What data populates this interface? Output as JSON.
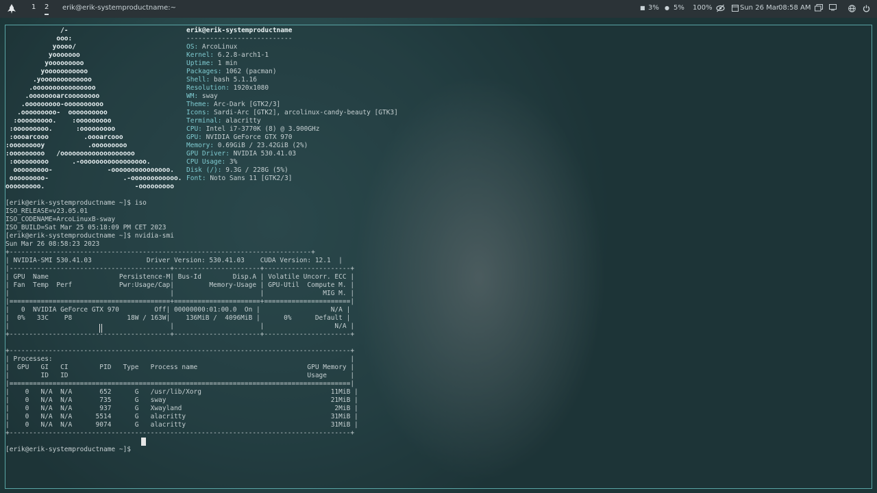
{
  "topbar": {
    "workspaces": [
      "1",
      "2"
    ],
    "window_title": "erik@erik-systemproductname:~",
    "cpu": "3%",
    "mem": "5%",
    "brightness": "100%",
    "date": "Sun 26 Mar",
    "time": "08:58 AM"
  },
  "terminal": {
    "logo_lines": [
      "              /-",
      "             ooo:",
      "            yoooo/",
      "           yooooooo",
      "          yooooooooo",
      "         yooooooooooo",
      "       .yooooooooooooo",
      "      .oooooooooooooooo",
      "     .oooooooarcoooooooo",
      "    .ooooooooo-oooooooooo",
      "   .ooooooooo-  oooooooooo",
      "  :ooooooooo.    :ooooooooo",
      " :ooooooooo.      :ooooooooo",
      " :oooarcooo         .oooarcooo",
      ":ooooooooy           .ooooooooo",
      ":ooooooooo   /ooooooooooooooooooo",
      " :ooooooooo      .-ooooooooooooooooo.",
      "  ooooooooo-              -ooooooooooooooo.",
      " ooooooooo-                   .-oooooooooooo.",
      "ooooooooo.                       -ooooooooo"
    ],
    "info_header": "erik@erik-systemproductname",
    "info_sep": "---------------------------",
    "info": [
      {
        "k": "OS",
        "v": "ArcoLinux"
      },
      {
        "k": "Kernel",
        "v": "6.2.8-arch1-1"
      },
      {
        "k": "Uptime",
        "v": "1 min"
      },
      {
        "k": "Packages",
        "v": "1062 (pacman)"
      },
      {
        "k": "Shell",
        "v": "bash 5.1.16"
      },
      {
        "k": "Resolution",
        "v": "1920x1080"
      },
      {
        "k": "WM",
        "v": "sway"
      },
      {
        "k": "Theme",
        "v": "Arc-Dark [GTK2/3]"
      },
      {
        "k": "Icons",
        "v": "Sardi-Arc [GTK2], arcolinux-candy-beauty [GTK3]"
      },
      {
        "k": "Terminal",
        "v": "alacritty"
      },
      {
        "k": "CPU",
        "v": "Intel i7-3770K (8) @ 3.900GHz"
      },
      {
        "k": "GPU",
        "v": "NVIDIA GeForce GTX 970"
      },
      {
        "k": "Memory",
        "v": "0.69GiB / 23.42GiB (2%)"
      },
      {
        "k": "GPU Driver",
        "v": "NVIDIA 530.41.03"
      },
      {
        "k": "CPU Usage",
        "v": "3%"
      },
      {
        "k": "Disk (/)",
        "v": "9.3G / 228G (5%)"
      },
      {
        "k": "Font",
        "v": "Noto Sans 11 [GTK2/3]"
      }
    ],
    "output_lines": [
      "[erik@erik-systemproductname ~]$ iso",
      "ISO_RELEASE=v23.05.01",
      "ISO_CODENAME=ArcoLinuxB-sway",
      "ISO_BUILD=Sat Mar 25 05:18:09 PM CET 2023",
      "[erik@erik-systemproductname ~]$ nvidia-smi",
      "Sun Mar 26 08:58:23 2023",
      "+-----------------------------------------------------------------------------+",
      "| NVIDIA-SMI 530.41.03              Driver Version: 530.41.03    CUDA Version: 12.1  |",
      "|-----------------------------------------+----------------------+----------------------+",
      "| GPU  Name                  Persistence-M| Bus-Id        Disp.A | Volatile Uncorr. ECC |",
      "| Fan  Temp  Perf            Pwr:Usage/Cap|         Memory-Usage | GPU-Util  Compute M. |",
      "|                                         |                      |               MIG M. |",
      "|=========================================+======================+======================|",
      "|   0  NVIDIA GeForce GTX 970         Off| 00000000:01:00.0  On |                  N/A |",
      "|  0%   33C    P8              18W / 163W|    136MiB /  4096MiB |      0%      Default |",
      "|                                         |                      |                  N/A |",
      "+-----------------------------------------+----------------------+----------------------+",
      "",
      "+---------------------------------------------------------------------------------------+",
      "| Processes:                                                                            |",
      "|  GPU   GI   CI        PID   Type   Process name                            GPU Memory |",
      "|        ID   ID                                                             Usage      |",
      "|=======================================================================================|",
      "|    0   N/A  N/A       652      G   /usr/lib/Xorg                                 11MiB |",
      "|    0   N/A  N/A       735      G   sway                                          21MiB |",
      "|    0   N/A  N/A       937      G   Xwayland                                       2MiB |",
      "|    0   N/A  N/A      5514      G   alacritty                                     31MiB |",
      "|    0   N/A  N/A      9074      G   alacritty                                     31MiB |",
      "+---------------------------------------------------------------------------------------+",
      "",
      "[erik@erik-systemproductname ~]$"
    ]
  }
}
